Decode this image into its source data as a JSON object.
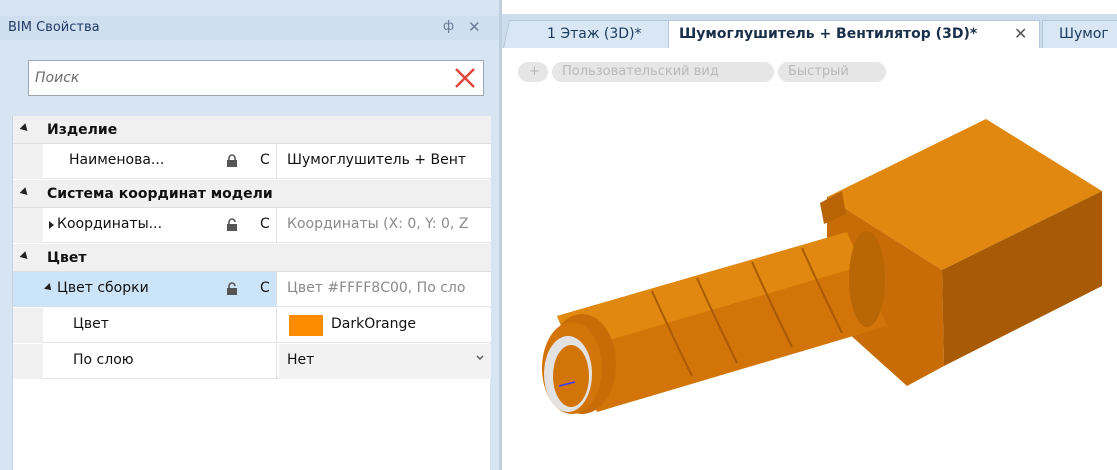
{
  "panel": {
    "title": "BIM Свойства",
    "pin_glyph": "ф",
    "close_glyph": "✕",
    "search_placeholder": "Поиск"
  },
  "properties": {
    "categories": [
      {
        "label": "Изделие"
      },
      {
        "label": "Система координат модели"
      },
      {
        "label": "Цвет"
      }
    ],
    "rows": {
      "name": {
        "label": "Наименова...",
        "flag": "C",
        "value": "Шумоглушитель + Вент"
      },
      "coords": {
        "label": "Координаты...",
        "flag": "C",
        "value": "Координаты (X: 0, Y: 0, Z"
      },
      "assembly_color": {
        "label": "Цвет сборки",
        "flag": "C",
        "value": "Цвет #FFFF8C00, По сло"
      },
      "color": {
        "label": "Цвет",
        "value": "DarkOrange"
      },
      "by_layer": {
        "label": "По слою",
        "value": "Нет"
      }
    }
  },
  "tabs": [
    {
      "label": "1 Этаж (3D)*"
    },
    {
      "label": "Шумоглушитель + Вентилятор (3D)*",
      "close": "✕"
    },
    {
      "label": "Шумог"
    }
  ],
  "view_toolbar": {
    "add": "+",
    "custom_view": "Пользовательский вид",
    "quick": "Быстрый"
  },
  "colors": {
    "swatch": "#FF8C00",
    "model_main": "#D27408",
    "model_dark": "#A25604",
    "model_light": "#E0880F"
  }
}
